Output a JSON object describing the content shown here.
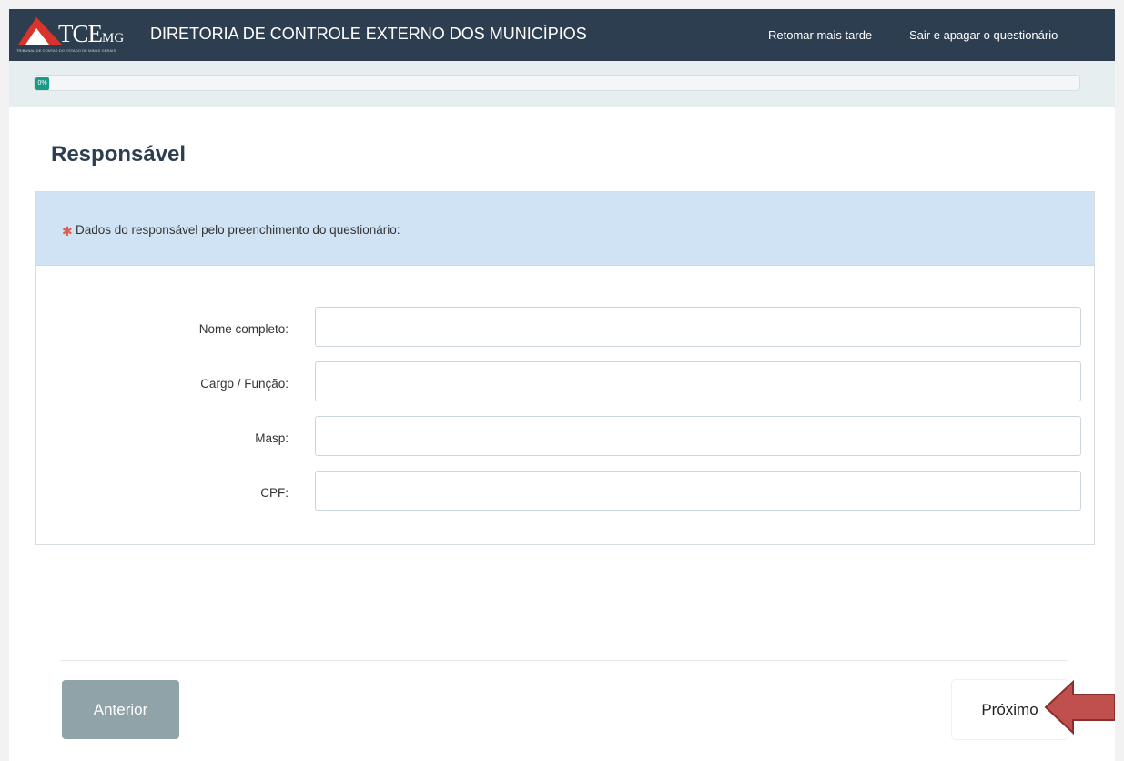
{
  "header": {
    "logo": {
      "mark": "TCE",
      "suffix": "MG",
      "caption": "TRIBUNAL DE CONTAS DO ESTADO DE MINAS GERAIS"
    },
    "title": "DIRETORIA DE CONTROLE EXTERNO DOS MUNICÍPIOS",
    "links": {
      "resume_later": "Retomar mais tarde",
      "exit_and_delete": "Sair e apagar o questionário"
    }
  },
  "progress": {
    "percent": 0,
    "label": "0%"
  },
  "section": {
    "title": "Responsável",
    "prompt": "Dados do responsável pelo preenchimento do questionário:",
    "required_marker": "✱"
  },
  "form": {
    "fields": [
      {
        "label": "Nome completo:",
        "value": ""
      },
      {
        "label": "Cargo / Função:",
        "value": ""
      },
      {
        "label": "Masp:",
        "value": ""
      },
      {
        "label": "CPF:",
        "value": ""
      }
    ]
  },
  "navigation": {
    "previous_label": "Anterior",
    "next_label": "Próximo"
  },
  "colors": {
    "header_bg": "#2d3e50",
    "progress_fill": "#1a9b8a",
    "panel_head_bg": "#cfe3f5",
    "required": "#e25a4c",
    "prev_button_bg": "#8fa3a8",
    "annotation_arrow": "#c0504d"
  },
  "icons": {
    "logo": "triangle-logo-icon",
    "annotation": "left-arrow-annotation-icon"
  }
}
